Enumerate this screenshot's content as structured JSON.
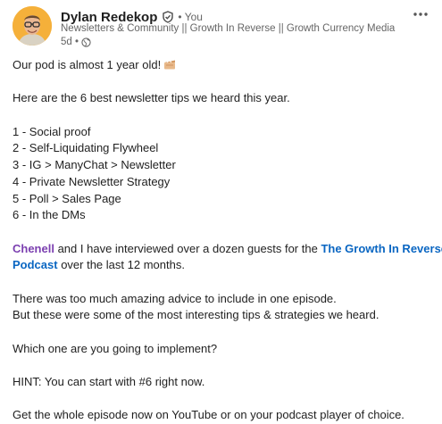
{
  "author": {
    "name": "Dylan Redekop",
    "you_badge": "• You",
    "headline": "Newsletters & Community || Growth In Reverse || Growth Currency Media",
    "time": "5d •"
  },
  "icons": {
    "verified": "verified-shield-icon",
    "visibility": "globe-icon",
    "more": "more-options-icon",
    "emoji": "party-clapper-icon"
  },
  "post": {
    "intro": "Our pod is almost 1 year old!",
    "subhead": "Here are the 6 best newsletter tips we heard this year.",
    "tips": [
      "1 - Social proof",
      "2 - Self-Liquidating Flywheel",
      "3 - IG > ManyChat > Newsletter",
      "4 - Private Newsletter Strategy",
      "5 - Poll > Sales Page",
      "6 - In the DMs"
    ],
    "mention": "Chenell",
    "interview_text": " and I have interviewed over a dozen guests for the ",
    "podcast_link_part1": "The Growth In Reverse",
    "podcast_link_part2": "Podcast",
    "interview_tail": " over the last 12 months.",
    "advice_line1": "There was too much amazing advice to include in one episode.",
    "advice_line2": "But these were some of the most interesting tips & strategies we heard.",
    "question": "Which one are you going to implement?",
    "hint": "HINT: You can start with #6 right now.",
    "cta": "Get the whole episode now on YouTube or on your podcast player of choice."
  },
  "colors": {
    "mention": "#7b3fb0",
    "link": "#0a66c2",
    "muted": "#666666",
    "avatar_bg": "#f5b03a"
  }
}
